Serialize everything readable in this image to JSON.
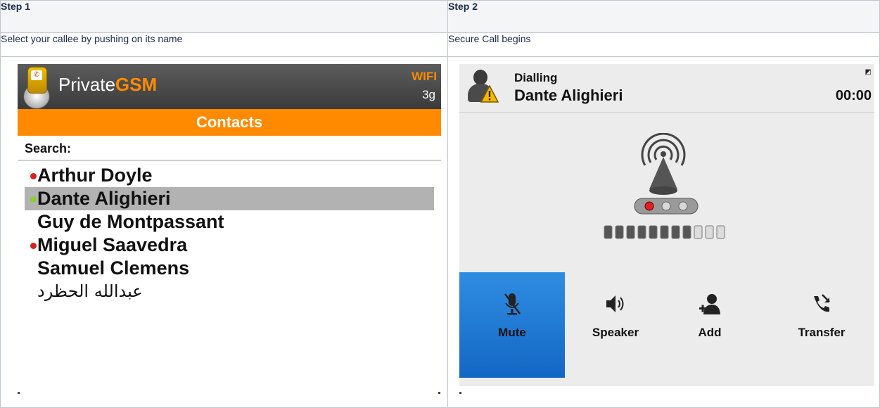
{
  "headers": {
    "step1": "Step 1",
    "step2": "Step 2"
  },
  "descriptions": {
    "step1": "Select your callee by pushing on its name",
    "step2": "Secure Call begins"
  },
  "phone1": {
    "brand_prefix": "Private",
    "brand_suffix": "GSM",
    "wifi_label": "WIFI",
    "network_label": "3g",
    "title_bar": "Contacts",
    "search_label": "Search:",
    "contacts": [
      {
        "name": "Arthur Doyle",
        "status": "red"
      },
      {
        "name": "Dante Alighieri",
        "status": "green",
        "selected": true
      },
      {
        "name": "Guy de Montpassant",
        "status": "none"
      },
      {
        "name": "Miguel Saavedra",
        "status": "red"
      },
      {
        "name": "Samuel Clemens",
        "status": "none"
      },
      {
        "name": "عبدالله الحظرد",
        "status": "none"
      }
    ],
    "colors": {
      "accent": "#ff8a00",
      "header_bg": "#4a4a4a",
      "selection": "#b2b2b2"
    }
  },
  "phone2": {
    "state": "Dialling",
    "callee": "Dante Alighieri",
    "timer": "00:00",
    "meter_filled": 8,
    "meter_total": 11,
    "buttons": [
      {
        "label": "Mute",
        "icon": "muted-mic-icon",
        "active": true
      },
      {
        "label": "Speaker",
        "icon": "speaker-icon",
        "active": false
      },
      {
        "label": "Add",
        "icon": "add-person-icon",
        "active": false
      },
      {
        "label": "Transfer",
        "icon": "transfer-call-icon",
        "active": false
      }
    ],
    "colors": {
      "active_button": "#1f7ad6",
      "background": "#ececec"
    }
  }
}
